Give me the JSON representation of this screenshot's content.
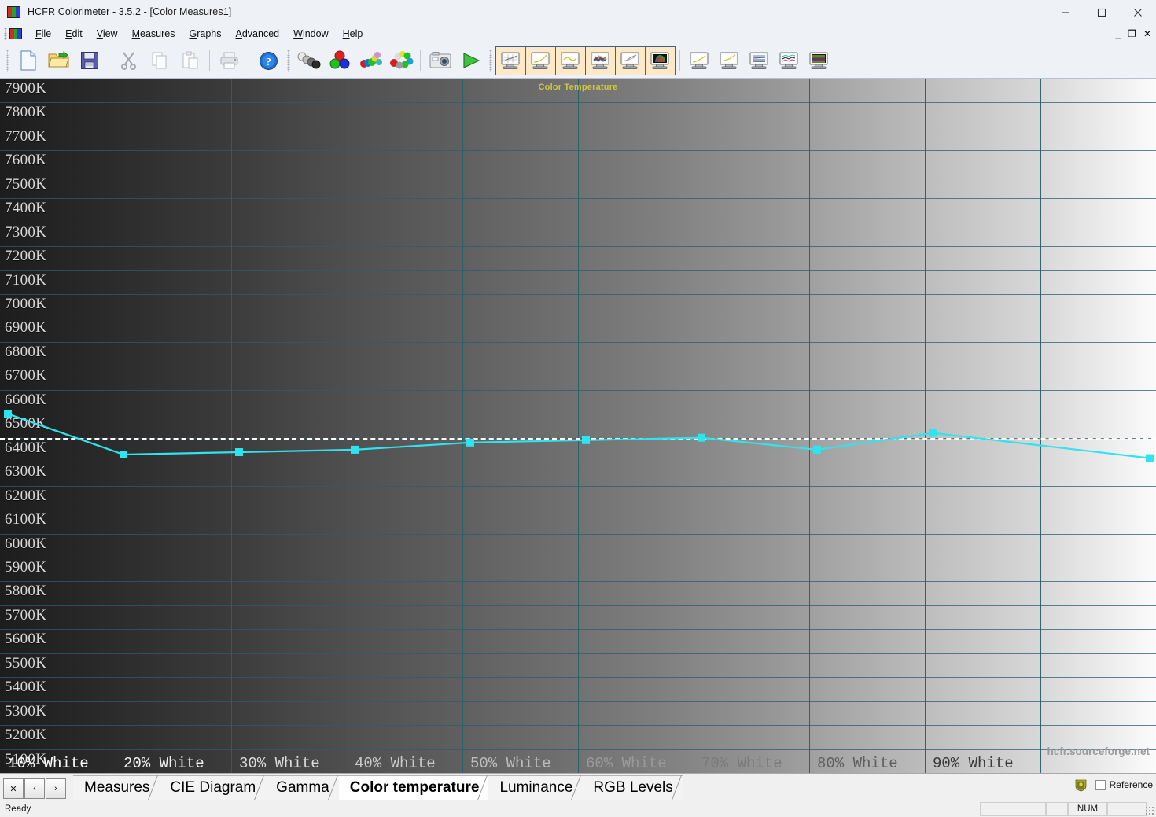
{
  "window": {
    "title": "HCFR Colorimeter - 3.5.2 - [Color Measures1]",
    "minimize": "minimize-icon",
    "maximize": "maximize-icon",
    "close": "close-icon",
    "mdi_minimize": "_",
    "mdi_restore": "❐",
    "mdi_close": "✕"
  },
  "menu": {
    "items": [
      {
        "label": "File",
        "accel": "F"
      },
      {
        "label": "Edit",
        "accel": "E"
      },
      {
        "label": "View",
        "accel": "V"
      },
      {
        "label": "Measures",
        "accel": "M"
      },
      {
        "label": "Graphs",
        "accel": "G"
      },
      {
        "label": "Advanced",
        "accel": "A"
      },
      {
        "label": "Window",
        "accel": "W"
      },
      {
        "label": "Help",
        "accel": "H"
      }
    ]
  },
  "toolbar": {
    "file_group": [
      {
        "name": "new-document-icon",
        "title": "New"
      },
      {
        "name": "open-folder-icon",
        "title": "Open"
      },
      {
        "name": "save-disk-icon",
        "title": "Save"
      }
    ],
    "edit_group": [
      {
        "name": "cut-scissors-icon",
        "title": "Cut"
      },
      {
        "name": "copy-icon",
        "title": "Copy"
      },
      {
        "name": "paste-icon",
        "title": "Paste"
      }
    ],
    "print_group": [
      {
        "name": "print-icon",
        "title": "Print"
      }
    ],
    "help_group": [
      {
        "name": "help-question-icon",
        "title": "Help"
      }
    ],
    "measure_group": [
      {
        "name": "grayscale-measure-icon",
        "title": "Grayscale measures"
      },
      {
        "name": "primary-colors-icon",
        "title": "Primary colors"
      },
      {
        "name": "saturations-icon",
        "title": "Saturations"
      },
      {
        "name": "full-measures-icon",
        "title": "Full measures"
      },
      {
        "name": "camera-icon",
        "title": "Capture"
      },
      {
        "name": "run-play-icon",
        "title": "Run measures"
      }
    ],
    "graph_group": [
      {
        "name": "graph-measures-icon",
        "active": true
      },
      {
        "name": "graph-gamma-icon",
        "active": true
      },
      {
        "name": "graph-color-temp-icon",
        "active": true
      },
      {
        "name": "graph-rgb-levels-icon",
        "active": true
      },
      {
        "name": "graph-luminance-icon",
        "active": true
      },
      {
        "name": "graph-cie-diagram-icon",
        "active": true
      }
    ],
    "graph_group2": [
      {
        "name": "graph-curve-a-icon",
        "active": false
      },
      {
        "name": "graph-curve-b-icon",
        "active": false
      },
      {
        "name": "graph-levels-a-icon",
        "active": false
      },
      {
        "name": "graph-levels-b-icon",
        "active": false
      },
      {
        "name": "graph-levels-c-icon",
        "active": false
      }
    ]
  },
  "chart_data": {
    "type": "line",
    "title": "Color Temperature",
    "xlabel": "",
    "ylabel": "",
    "watermark": "hcfr.sourceforge.net",
    "categories": [
      "10% White",
      "20% White",
      "30% White",
      "40% White",
      "50% White",
      "60% White",
      "70% White",
      "80% White",
      "90% White"
    ],
    "values": [
      6600,
      6430,
      6440,
      6450,
      6480,
      6490,
      6500,
      6450,
      6520
    ],
    "series": [
      {
        "name": "Color temperature",
        "color": "#2fe3ef",
        "values": [
          6600,
          6430,
          6440,
          6450,
          6480,
          6490,
          6500,
          6450,
          6520
        ]
      }
    ],
    "reference_line": {
      "value": 6500,
      "label": "6500K",
      "color": "#ffffff",
      "style": "dashed"
    },
    "ylim": [
      5100,
      7900
    ],
    "ytick_step": 100,
    "yticks": [
      "7900K",
      "7800K",
      "7700K",
      "7600K",
      "7500K",
      "7400K",
      "7300K",
      "7200K",
      "7100K",
      "7000K",
      "6900K",
      "6800K",
      "6700K",
      "6600K",
      "6500K",
      "6400K",
      "6300K",
      "6200K",
      "6100K",
      "6000K",
      "5900K",
      "5800K",
      "5700K",
      "5600K",
      "5500K",
      "5400K",
      "5300K",
      "5200K",
      "5100K"
    ],
    "grid": true,
    "legend": "none"
  },
  "tabbar": {
    "nav": {
      "close": "✕",
      "prev": "‹",
      "next": "›"
    },
    "tabs": [
      {
        "label": "Measures",
        "active": false
      },
      {
        "label": "CIE Diagram",
        "active": false
      },
      {
        "label": "Gamma",
        "active": false
      },
      {
        "label": "Color temperature",
        "active": true
      },
      {
        "label": "Luminance",
        "active": false
      },
      {
        "label": "RGB Levels",
        "active": false
      }
    ],
    "shield_icon": "shield-icon",
    "reference_label": "Reference",
    "reference_checked": false
  },
  "statusbar": {
    "message": "Ready",
    "num_indicator": "NUM"
  }
}
